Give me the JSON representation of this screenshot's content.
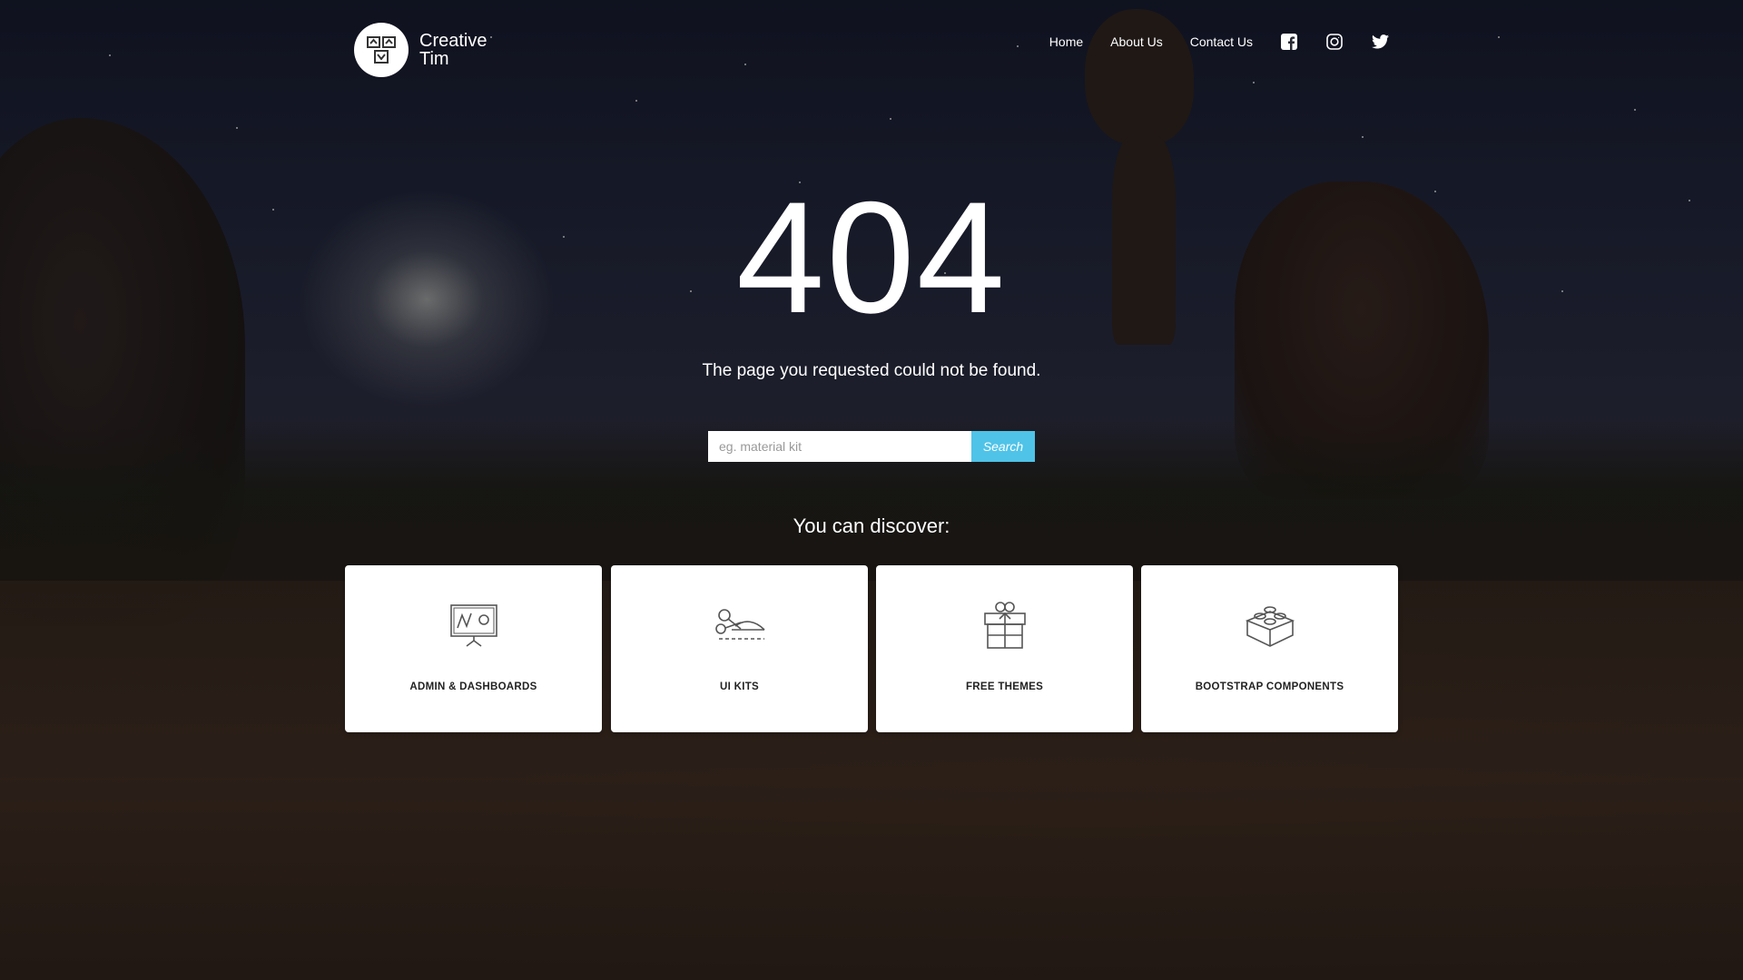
{
  "brand": {
    "name_line1": "Creative",
    "name_line2": "Tim",
    "logo_icon": "creative-tim-logo"
  },
  "nav": {
    "items": [
      {
        "label": "Home"
      },
      {
        "label": "About Us"
      },
      {
        "label": "Contact Us"
      }
    ],
    "social": [
      {
        "icon": "facebook-icon"
      },
      {
        "icon": "instagram-icon"
      },
      {
        "icon": "twitter-icon"
      }
    ]
  },
  "error": {
    "code": "404",
    "message": "The page you requested could not be found."
  },
  "search": {
    "placeholder": "eg. material kit",
    "value": "",
    "button_label": "Search",
    "button_color": "#4fc3e8"
  },
  "discover": {
    "title": "You can discover:",
    "cards": [
      {
        "label": "ADMIN & DASHBOARDS",
        "icon": "presentation-board-icon"
      },
      {
        "label": "UI KITS",
        "icon": "scissors-cut-icon"
      },
      {
        "label": "FREE THEMES",
        "icon": "gift-box-icon"
      },
      {
        "label": "BOOTSTRAP COMPONENTS",
        "icon": "lego-brick-icon"
      }
    ]
  }
}
